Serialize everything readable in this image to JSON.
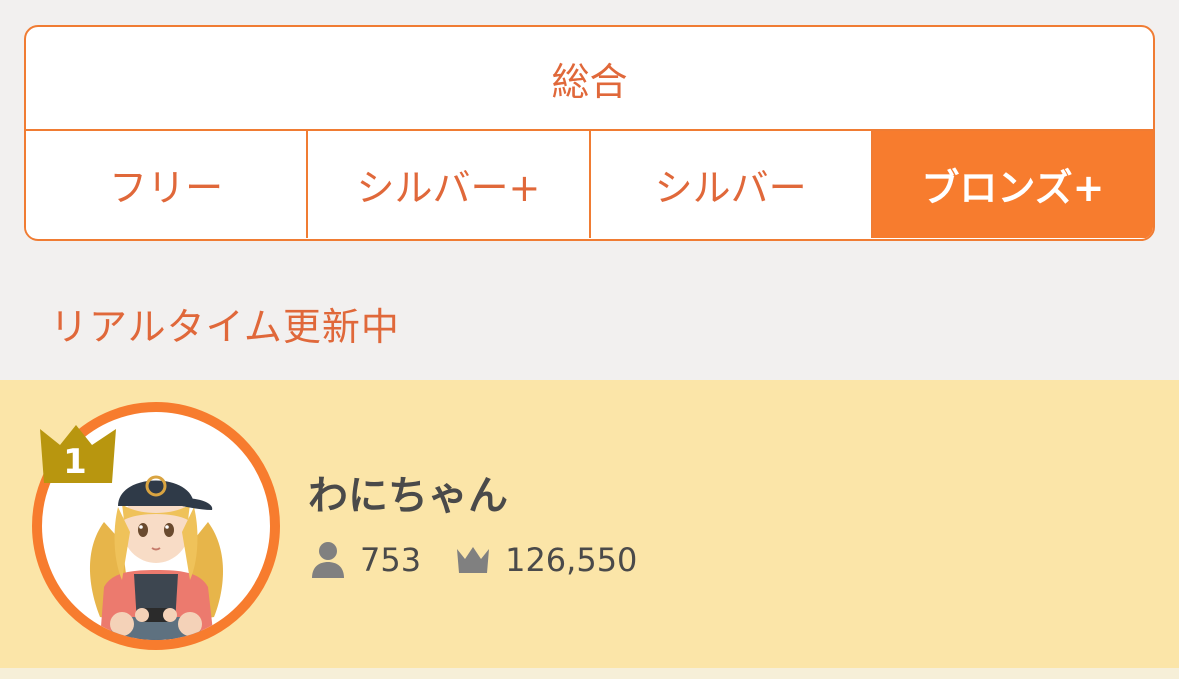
{
  "tabs": {
    "overall": "総合",
    "items": [
      {
        "label": "フリー",
        "active": false
      },
      {
        "label": "シルバー+",
        "active": false
      },
      {
        "label": "シルバー",
        "active": false
      },
      {
        "label": "ブロンズ+",
        "active": true
      }
    ]
  },
  "status": {
    "realtime": "リアルタイム更新中"
  },
  "ranking": [
    {
      "rank": "1",
      "name": "わにちゃん",
      "followers": "753",
      "score": "126,550",
      "followers_icon": "person-icon",
      "score_icon": "crown-icon"
    }
  ],
  "colors": {
    "accent": "#f77c2e",
    "accent_text": "#e0683a",
    "highlight_row": "#fbe5a8",
    "background": "#f2f0ef",
    "rank_badge": "#b8960f",
    "stat_icon": "#808080"
  }
}
